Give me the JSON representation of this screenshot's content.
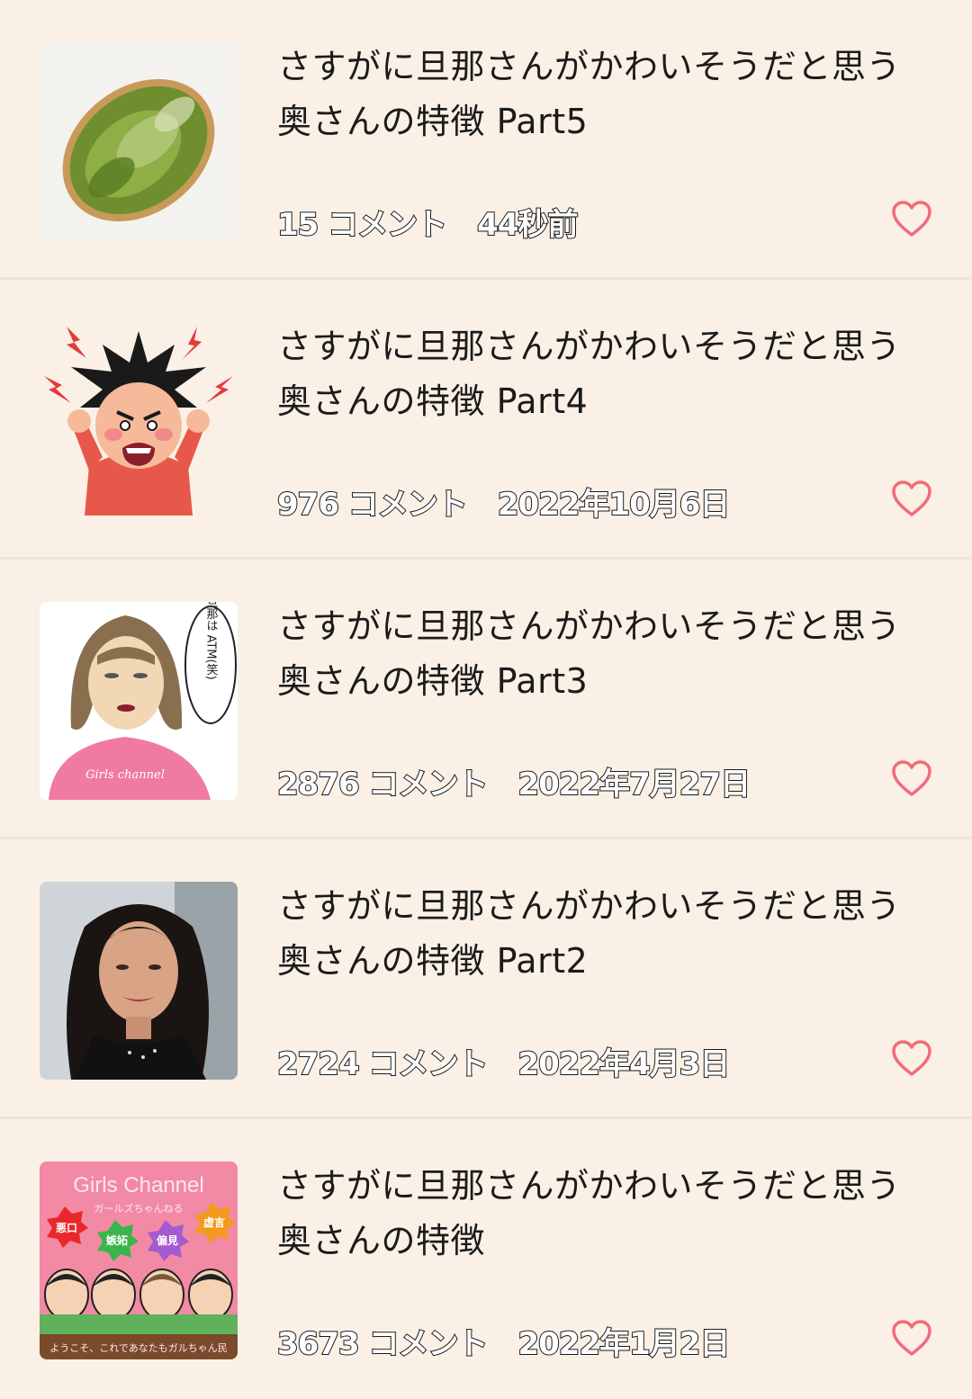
{
  "colors": {
    "background": "#faf0e6",
    "divider": "#efe4da",
    "heart": "#f26b7a"
  },
  "items": [
    {
      "title_line1": "さすがに旦那さんがかわいそうだと思う",
      "title_line2": "奥さんの特徴 Part5",
      "comments": "15 コメント",
      "time": "44秒前",
      "thumbnail": "sprouts-bento-image"
    },
    {
      "title_line1": "さすがに旦那さんがかわいそうだと思う",
      "title_line2": "奥さんの特徴 Part4",
      "comments": "976 コメント",
      "time": "2022年10月6日",
      "thumbnail": "angry-person-illustration"
    },
    {
      "title_line1": "さすがに旦那さんがかわいそうだと思う",
      "title_line2": "奥さんの特徴 Part3",
      "comments": "2876 コメント",
      "time": "2022年7月27日",
      "thumbnail": "woman-caricature-illustration",
      "thumb_speech": "旦那は ATM(笑)",
      "thumb_caption": "Girls channel"
    },
    {
      "title_line1": "さすがに旦那さんがかわいそうだと思う",
      "title_line2": "奥さんの特徴 Part2",
      "comments": "2724 コメント",
      "time": "2022年4月3日",
      "thumbnail": "woman-photo"
    },
    {
      "title_line1": "さすがに旦那さんがかわいそうだと思う",
      "title_line2": "奥さんの特徴",
      "comments": "3673 コメント",
      "time": "2022年1月2日",
      "thumbnail": "girls-channel-banner",
      "thumb_title": "Girls Channel",
      "thumb_subtitle": "ガールズちゃんねる",
      "thumb_badges": [
        "悪口",
        "嫉妬",
        "偏見",
        "虚言"
      ],
      "thumb_footer": "ようこそ、これであなたもガルちゃん民"
    }
  ]
}
